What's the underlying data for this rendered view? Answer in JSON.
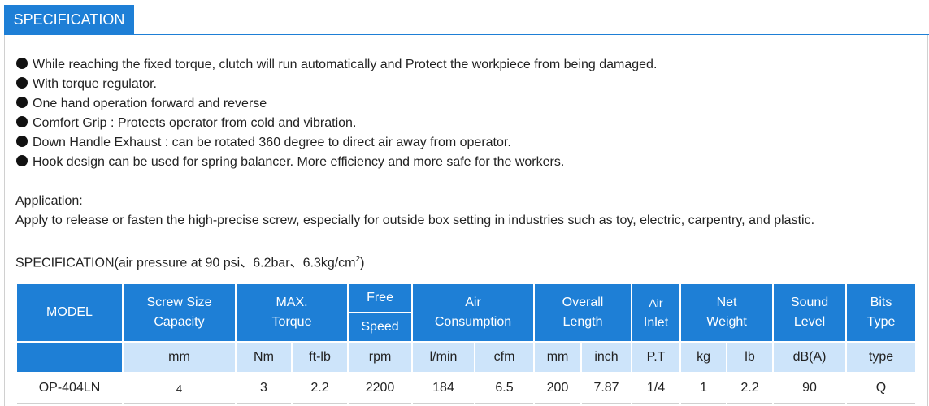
{
  "tab": {
    "label": "SPECIFICATION"
  },
  "features": [
    "While reaching the fixed torque, clutch will run automatically and Protect the workpiece from being damaged.",
    "With torque regulator.",
    "One hand operation forward and reverse",
    "Comfort Grip : Protects operator from cold and vibration.",
    "Down Handle Exhaust : can be rotated 360 degree to direct air away from operator.",
    "Hook design can be used for spring balancer. More efficiency and more safe for the workers."
  ],
  "application": {
    "heading": "Application:",
    "text": "Apply to release or fasten the high-precise screw, especially for outside box setting in industries such as toy, electric, carpentry, and plastic."
  },
  "spec_caption": {
    "prefix": "SPECIFICATION(air pressure at 90 psi、6.2bar、6.3kg/cm",
    "superscript": "2",
    "suffix": ")"
  },
  "table": {
    "headers": {
      "model": "MODEL",
      "screw_size_1": "Screw Size",
      "screw_size_2": "Capacity",
      "max_1": "MAX.",
      "max_2": "Torque",
      "free_1": "Free",
      "free_2": "Speed",
      "air_1": "Air",
      "air_2": "Consumption",
      "overall_1": "Overall",
      "overall_2": "Length",
      "inlet_1": "Air",
      "inlet_2": "Inlet",
      "net_1": "Net",
      "net_2": "Weight",
      "sound_1": "Sound",
      "sound_2": "Level",
      "bits_1": "Bits",
      "bits_2": "Type"
    },
    "units": [
      "mm",
      "Nm",
      "ft-lb",
      "rpm",
      "l/min",
      "cfm",
      "mm",
      "inch",
      "P.T",
      "kg",
      "lb",
      "dB(A)",
      "type"
    ],
    "rows": [
      {
        "model": "OP-404LN",
        "screw_mm": "4",
        "torque_nm": "3",
        "torque_ftlb": "2.2",
        "speed_rpm": "2200",
        "air_lmin": "184",
        "air_cfm": "6.5",
        "length_mm": "200",
        "length_inch": "7.87",
        "inlet": "1/4",
        "weight_kg": "1",
        "weight_lb": "2.2",
        "sound": "90",
        "bits": "Q"
      }
    ]
  }
}
